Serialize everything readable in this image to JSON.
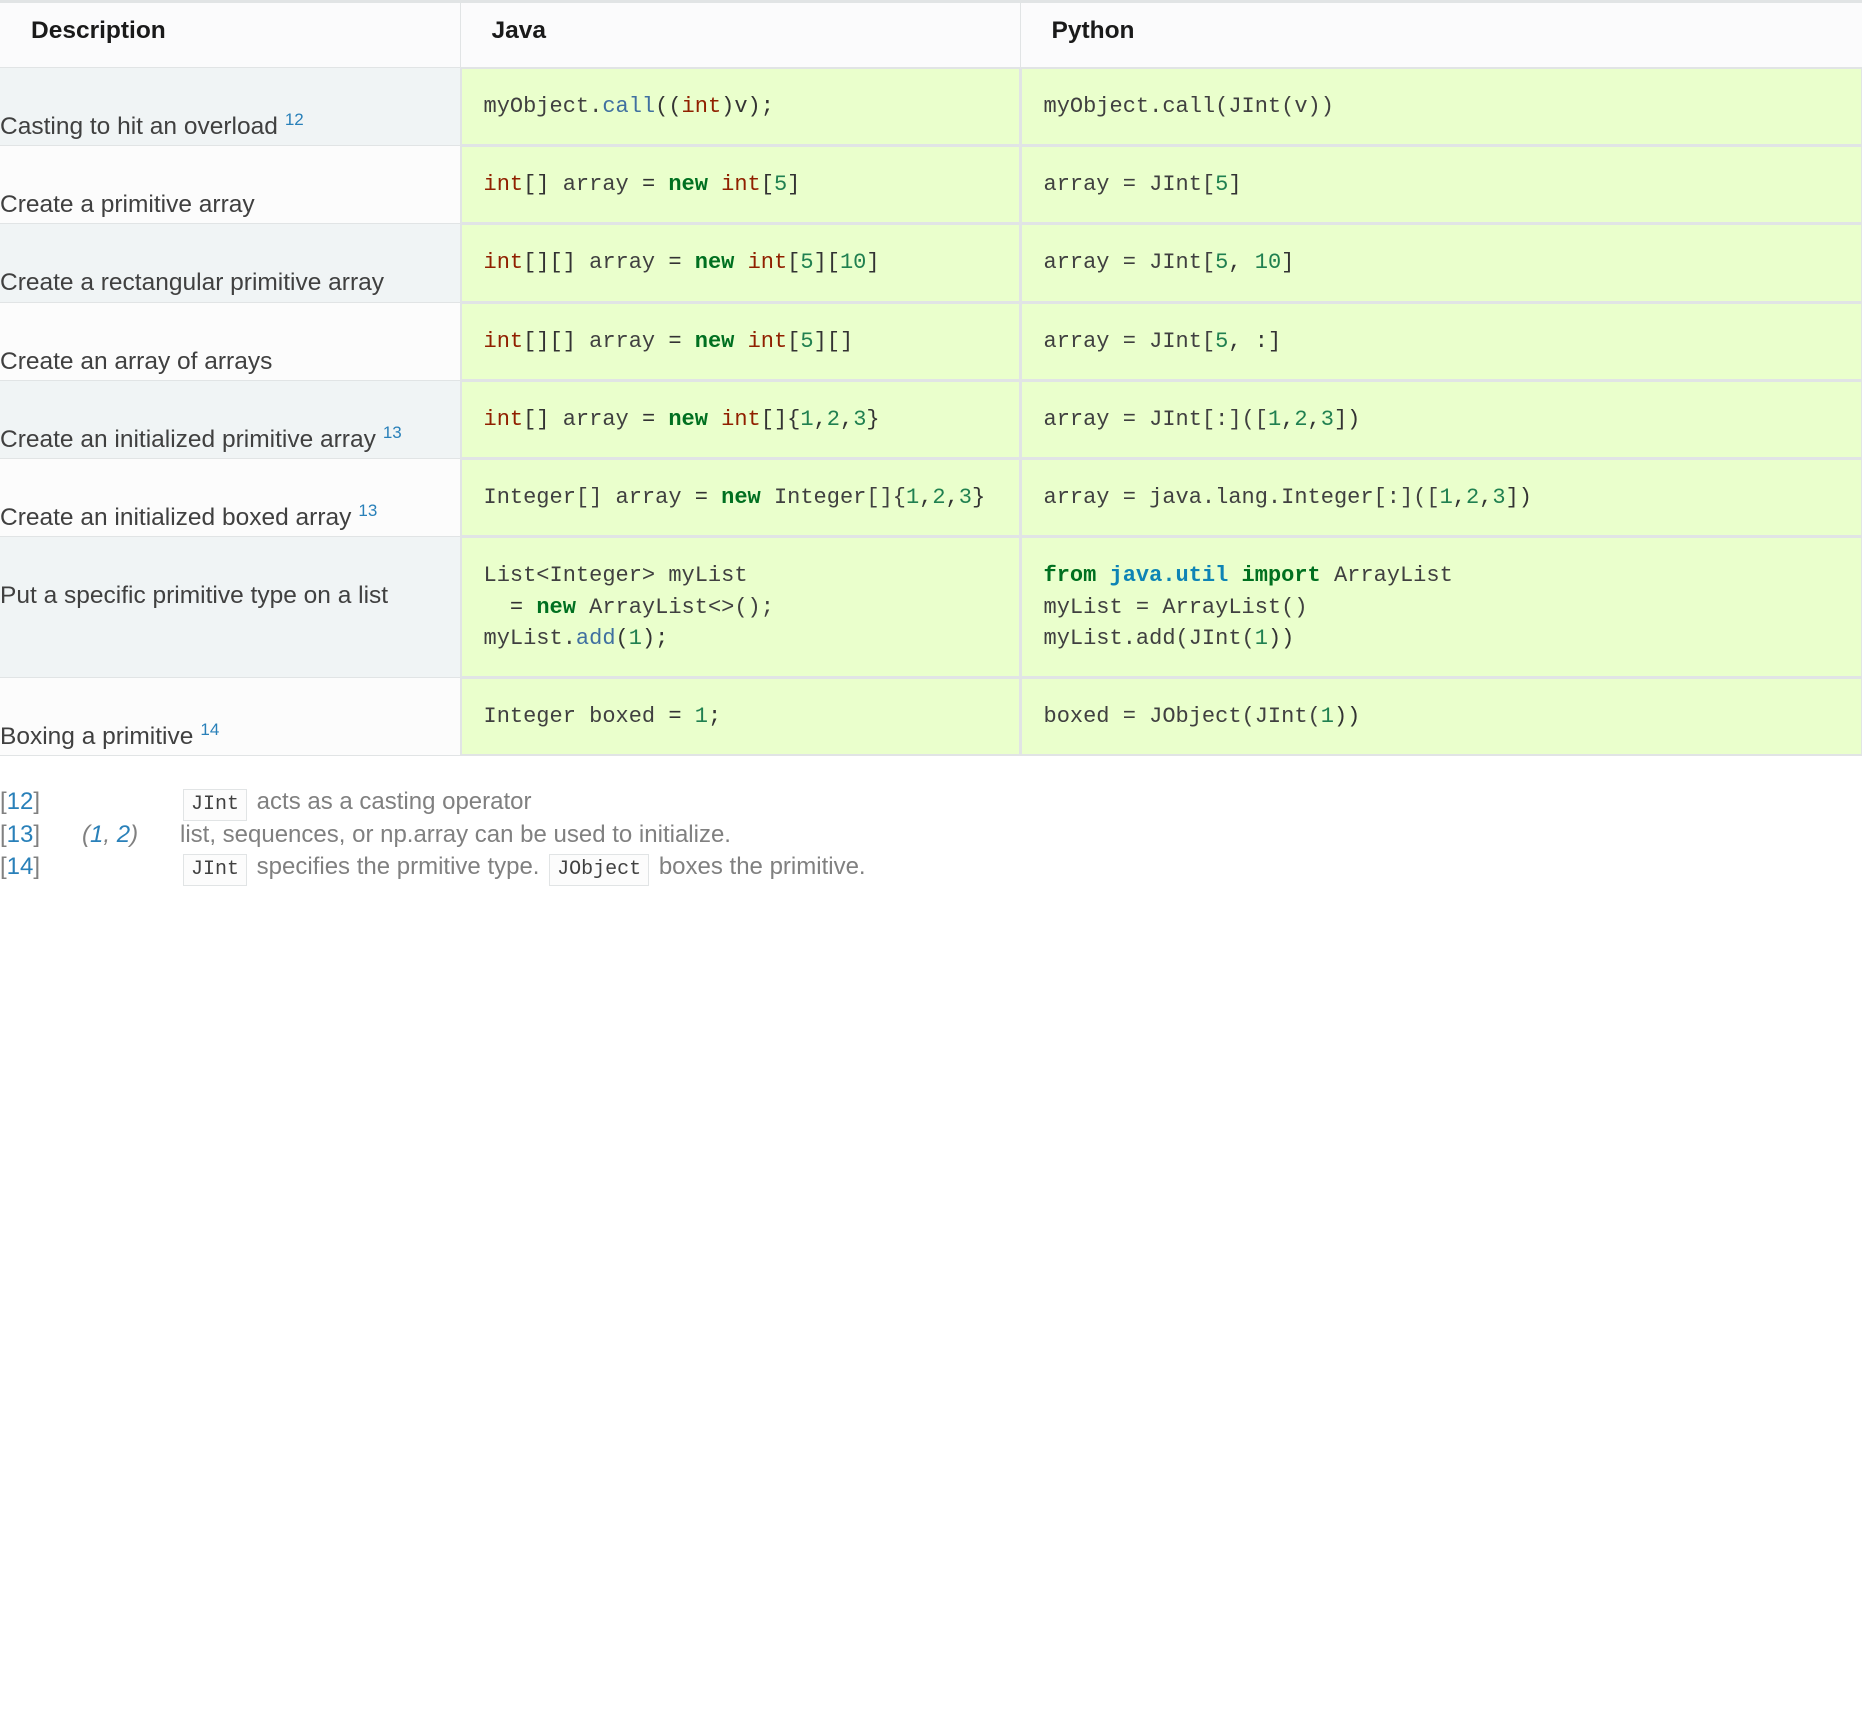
{
  "table": {
    "headers": [
      "Description",
      "Java",
      "Python"
    ],
    "rows": [
      {
        "description": "Casting to hit an overload",
        "footnote_ref": "12",
        "java": [
          [
            {
              "t": "myObject.",
              "c": "nx"
            },
            {
              "t": "call",
              "c": "na"
            },
            {
              "t": "((",
              "c": "p"
            },
            {
              "t": "int",
              "c": "kt"
            },
            {
              "t": ")v);",
              "c": "p"
            }
          ]
        ],
        "python": [
          [
            {
              "t": "myObject.call(JInt(v))",
              "c": "nx"
            }
          ]
        ]
      },
      {
        "description": "Create a primitive array",
        "footnote_ref": "",
        "java": [
          [
            {
              "t": "int",
              "c": "kt"
            },
            {
              "t": "[]",
              "c": "p"
            },
            {
              "t": " array ",
              "c": "nx"
            },
            {
              "t": "=",
              "c": "p"
            },
            {
              "t": " ",
              "c": "nx"
            },
            {
              "t": "new",
              "c": "k"
            },
            {
              "t": " ",
              "c": "nx"
            },
            {
              "t": "int",
              "c": "kt"
            },
            {
              "t": "[",
              "c": "p"
            },
            {
              "t": "5",
              "c": "mi"
            },
            {
              "t": "]",
              "c": "p"
            }
          ]
        ],
        "python": [
          [
            {
              "t": "array = JInt[",
              "c": "nx"
            },
            {
              "t": "5",
              "c": "mi"
            },
            {
              "t": "]",
              "c": "p"
            }
          ]
        ]
      },
      {
        "description": "Create a rectangular primitive array",
        "footnote_ref": "",
        "java": [
          [
            {
              "t": "int",
              "c": "kt"
            },
            {
              "t": "[][]",
              "c": "p"
            },
            {
              "t": " array ",
              "c": "nx"
            },
            {
              "t": "=",
              "c": "p"
            },
            {
              "t": " ",
              "c": "nx"
            },
            {
              "t": "new",
              "c": "k"
            },
            {
              "t": " ",
              "c": "nx"
            },
            {
              "t": "int",
              "c": "kt"
            },
            {
              "t": "[",
              "c": "p"
            },
            {
              "t": "5",
              "c": "mi"
            },
            {
              "t": "][",
              "c": "p"
            },
            {
              "t": "10",
              "c": "mi"
            },
            {
              "t": "]",
              "c": "p"
            }
          ]
        ],
        "python": [
          [
            {
              "t": "array = JInt[",
              "c": "nx"
            },
            {
              "t": "5",
              "c": "mi"
            },
            {
              "t": ", ",
              "c": "p"
            },
            {
              "t": "10",
              "c": "mi"
            },
            {
              "t": "]",
              "c": "p"
            }
          ]
        ]
      },
      {
        "description": "Create an array of arrays",
        "footnote_ref": "",
        "java": [
          [
            {
              "t": "int",
              "c": "kt"
            },
            {
              "t": "[][]",
              "c": "p"
            },
            {
              "t": " array ",
              "c": "nx"
            },
            {
              "t": "=",
              "c": "p"
            },
            {
              "t": " ",
              "c": "nx"
            },
            {
              "t": "new",
              "c": "k"
            },
            {
              "t": " ",
              "c": "nx"
            },
            {
              "t": "int",
              "c": "kt"
            },
            {
              "t": "[",
              "c": "p"
            },
            {
              "t": "5",
              "c": "mi"
            },
            {
              "t": "][]",
              "c": "p"
            }
          ]
        ],
        "python": [
          [
            {
              "t": "array = JInt[",
              "c": "nx"
            },
            {
              "t": "5",
              "c": "mi"
            },
            {
              "t": ", :]",
              "c": "p"
            }
          ]
        ]
      },
      {
        "description": "Create an initialized primitive array",
        "footnote_ref": "13",
        "java": [
          [
            {
              "t": "int",
              "c": "kt"
            },
            {
              "t": "[]",
              "c": "p"
            },
            {
              "t": " array ",
              "c": "nx"
            },
            {
              "t": "=",
              "c": "p"
            },
            {
              "t": " ",
              "c": "nx"
            },
            {
              "t": "new",
              "c": "k"
            },
            {
              "t": " ",
              "c": "nx"
            },
            {
              "t": "int",
              "c": "kt"
            },
            {
              "t": "[]{",
              "c": "p"
            },
            {
              "t": "1",
              "c": "mi"
            },
            {
              "t": ",",
              "c": "p"
            },
            {
              "t": "2",
              "c": "mi"
            },
            {
              "t": ",",
              "c": "p"
            },
            {
              "t": "3",
              "c": "mi"
            },
            {
              "t": "}",
              "c": "p"
            }
          ]
        ],
        "python": [
          [
            {
              "t": "array = JInt[:]([",
              "c": "nx"
            },
            {
              "t": "1",
              "c": "mi"
            },
            {
              "t": ",",
              "c": "p"
            },
            {
              "t": "2",
              "c": "mi"
            },
            {
              "t": ",",
              "c": "p"
            },
            {
              "t": "3",
              "c": "mi"
            },
            {
              "t": "])",
              "c": "p"
            }
          ]
        ]
      },
      {
        "description": "Create an initialized boxed array",
        "footnote_ref": "13",
        "java": [
          [
            {
              "t": "Integer[] array ",
              "c": "nx"
            },
            {
              "t": "=",
              "c": "p"
            },
            {
              "t": " ",
              "c": "nx"
            },
            {
              "t": "new",
              "c": "k"
            },
            {
              "t": " Integer[]{",
              "c": "nx"
            },
            {
              "t": "1",
              "c": "mi"
            },
            {
              "t": ",",
              "c": "p"
            },
            {
              "t": "2",
              "c": "mi"
            },
            {
              "t": ",",
              "c": "p"
            },
            {
              "t": "3",
              "c": "mi"
            },
            {
              "t": "}",
              "c": "p"
            }
          ]
        ],
        "python": [
          [
            {
              "t": "array = java.lang.Integer[:]([",
              "c": "nx"
            },
            {
              "t": "1",
              "c": "mi"
            },
            {
              "t": ",",
              "c": "p"
            },
            {
              "t": "2",
              "c": "mi"
            },
            {
              "t": ",",
              "c": "p"
            },
            {
              "t": "3",
              "c": "mi"
            },
            {
              "t": "])",
              "c": "p"
            }
          ]
        ]
      },
      {
        "description": "Put a specific primitive type on a list",
        "footnote_ref": "",
        "java": [
          [
            {
              "t": "List<Integer> myList",
              "c": "nx"
            }
          ],
          [
            {
              "t": "  ",
              "c": "nx"
            },
            {
              "t": "=",
              "c": "p"
            },
            {
              "t": " ",
              "c": "nx"
            },
            {
              "t": "new",
              "c": "k"
            },
            {
              "t": " ArrayList<>();",
              "c": "nx"
            }
          ],
          [
            {
              "t": "myList.",
              "c": "nx"
            },
            {
              "t": "add",
              "c": "na"
            },
            {
              "t": "(",
              "c": "p"
            },
            {
              "t": "1",
              "c": "mi"
            },
            {
              "t": ");",
              "c": "p"
            }
          ]
        ],
        "python": [
          [
            {
              "t": "from",
              "c": "kn"
            },
            {
              "t": " ",
              "c": "nx"
            },
            {
              "t": "java.util",
              "c": "nn"
            },
            {
              "t": " ",
              "c": "nx"
            },
            {
              "t": "import",
              "c": "kn"
            },
            {
              "t": " ArrayList",
              "c": "nx"
            }
          ],
          [
            {
              "t": "myList = ArrayList()",
              "c": "nx"
            }
          ],
          [
            {
              "t": "myList.add(JInt(",
              "c": "nx"
            },
            {
              "t": "1",
              "c": "mi"
            },
            {
              "t": "))",
              "c": "p"
            }
          ]
        ]
      },
      {
        "description": "Boxing a primitive",
        "footnote_ref": "14",
        "java": [
          [
            {
              "t": "Integer boxed ",
              "c": "nx"
            },
            {
              "t": "=",
              "c": "p"
            },
            {
              "t": " ",
              "c": "nx"
            },
            {
              "t": "1",
              "c": "mi"
            },
            {
              "t": ";",
              "c": "p"
            }
          ]
        ],
        "python": [
          [
            {
              "t": "boxed = JObject(JInt(",
              "c": "nx"
            },
            {
              "t": "1",
              "c": "mi"
            },
            {
              "t": "))",
              "c": "p"
            }
          ]
        ]
      }
    ]
  },
  "footnotes": [
    {
      "label_open": "[",
      "number": "12",
      "label_close": "]",
      "backrefs": [],
      "parts": [
        {
          "kind": "code",
          "text": "JInt"
        },
        {
          "kind": "text",
          "text": "acts as a casting operator"
        }
      ]
    },
    {
      "label_open": "[",
      "number": "13",
      "label_close": "]",
      "backrefs": [
        "1",
        "2"
      ],
      "parts": [
        {
          "kind": "text",
          "text": "list, sequences, or np.array can be used to initialize."
        }
      ]
    },
    {
      "label_open": "[",
      "number": "14",
      "label_close": "]",
      "backrefs": [],
      "parts": [
        {
          "kind": "code",
          "text": "JInt"
        },
        {
          "kind": "text",
          "text": "specifies the prmitive type."
        },
        {
          "kind": "code",
          "text": "JObject"
        },
        {
          "kind": "text",
          "text": "boxes the primitive."
        }
      ]
    }
  ],
  "colors": {
    "row_stripe": "#f0f4f5",
    "row_plain": "#fcfcfc",
    "header_bg": "#fbfbfc",
    "border": "#e1e4e5",
    "code_bg": "#eaffcc",
    "link": "#2980b9",
    "text": "#404040",
    "muted": "#808080",
    "tok_type": "#902000",
    "tok_keyword": "#007020",
    "tok_number": "#208050",
    "tok_method": "#4070a0",
    "tok_namespace": "#0e84b5"
  }
}
